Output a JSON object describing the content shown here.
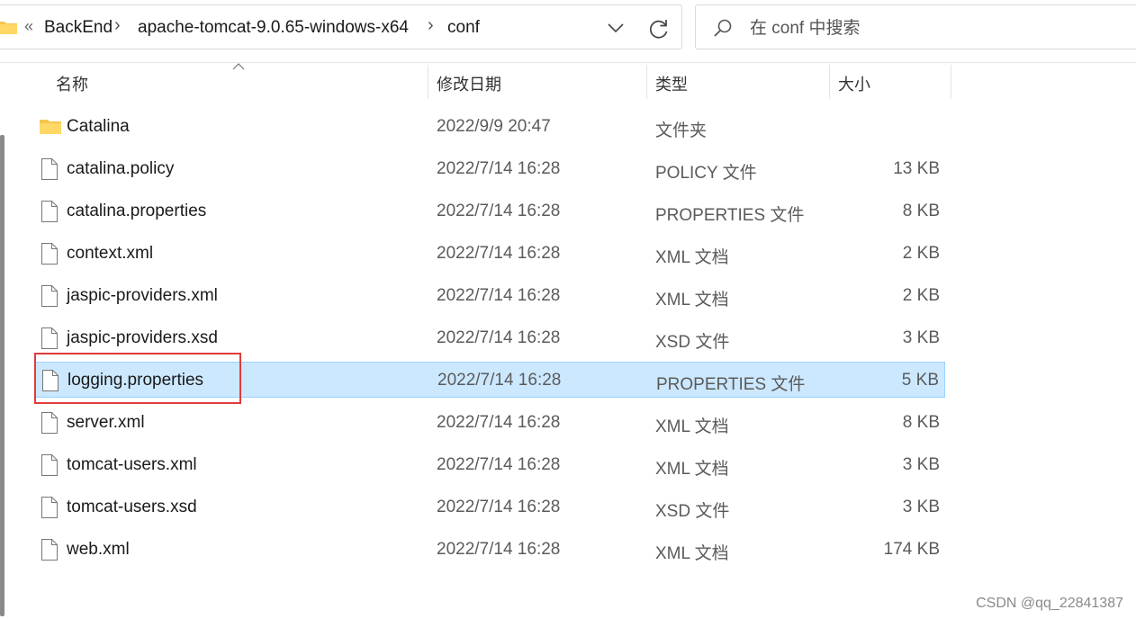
{
  "address": {
    "overflow_chevron": "«",
    "crumbs": [
      "BackEnd",
      "apache-tomcat-9.0.65-windows-x64",
      "conf"
    ],
    "separator": "›"
  },
  "search": {
    "placeholder": "在 conf 中搜索"
  },
  "columns": {
    "name": "名称",
    "date": "修改日期",
    "type": "类型",
    "size": "大小"
  },
  "files": [
    {
      "name": "Catalina",
      "date": "2022/9/9 20:47",
      "type": "文件夹",
      "size": "",
      "icon": "folder-icon"
    },
    {
      "name": "catalina.policy",
      "date": "2022/7/14 16:28",
      "type": "POLICY 文件",
      "size": "13 KB",
      "icon": "file-icon"
    },
    {
      "name": "catalina.properties",
      "date": "2022/7/14 16:28",
      "type": "PROPERTIES 文件",
      "size": "8 KB",
      "icon": "file-icon"
    },
    {
      "name": "context.xml",
      "date": "2022/7/14 16:28",
      "type": "XML 文档",
      "size": "2 KB",
      "icon": "file-icon"
    },
    {
      "name": "jaspic-providers.xml",
      "date": "2022/7/14 16:28",
      "type": "XML 文档",
      "size": "2 KB",
      "icon": "file-icon"
    },
    {
      "name": "jaspic-providers.xsd",
      "date": "2022/7/14 16:28",
      "type": "XSD 文件",
      "size": "3 KB",
      "icon": "file-icon"
    },
    {
      "name": "logging.properties",
      "date": "2022/7/14 16:28",
      "type": "PROPERTIES 文件",
      "size": "5 KB",
      "icon": "file-icon"
    },
    {
      "name": "server.xml",
      "date": "2022/7/14 16:28",
      "type": "XML 文档",
      "size": "8 KB",
      "icon": "file-icon"
    },
    {
      "name": "tomcat-users.xml",
      "date": "2022/7/14 16:28",
      "type": "XML 文档",
      "size": "3 KB",
      "icon": "file-icon"
    },
    {
      "name": "tomcat-users.xsd",
      "date": "2022/7/14 16:28",
      "type": "XSD 文件",
      "size": "3 KB",
      "icon": "file-icon"
    },
    {
      "name": "web.xml",
      "date": "2022/7/14 16:28",
      "type": "XML 文档",
      "size": "174 KB",
      "icon": "file-icon"
    }
  ],
  "selected_file": "logging.properties",
  "colors": {
    "selection_bg": "#cce8ff",
    "selection_border": "#99d1ff",
    "annotation": "#e03b3b",
    "folder": "#f4c64f"
  },
  "watermark": "CSDN @qq_22841387"
}
